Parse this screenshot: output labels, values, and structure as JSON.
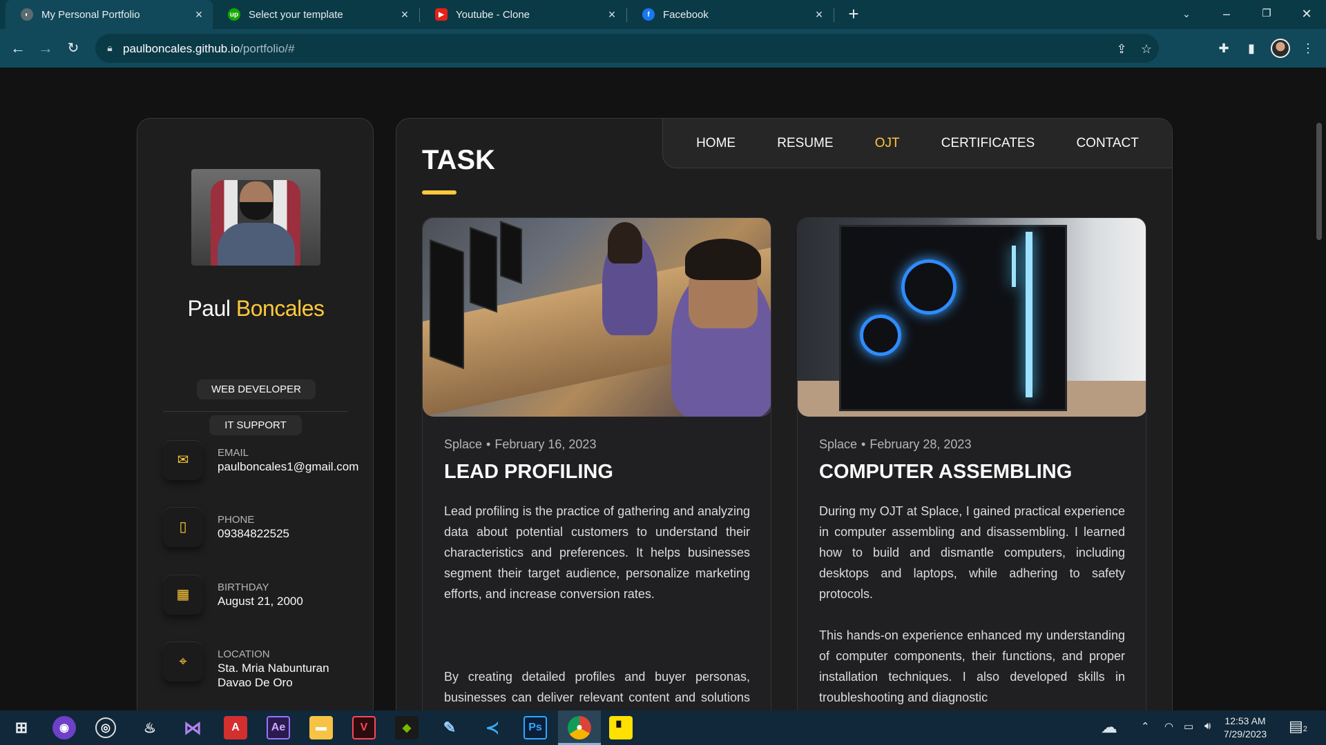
{
  "browser": {
    "tabs": [
      {
        "title": "My Personal Portfolio",
        "icon": "globe-icon",
        "active": true
      },
      {
        "title": "Select your template",
        "icon": "upwork-icon",
        "active": false
      },
      {
        "title": "Youtube - Clone",
        "icon": "youtube-icon",
        "active": false
      },
      {
        "title": "Facebook",
        "icon": "facebook-icon",
        "active": false
      }
    ],
    "url_host": "paulboncales.github.io",
    "url_path": "/portfolio/#"
  },
  "sidebar": {
    "first_name": "Paul",
    "last_name": "Boncales",
    "badges": [
      "WEB DEVELOPER",
      "IT SUPPORT"
    ],
    "contacts": [
      {
        "label": "EMAIL",
        "value": "paulboncales1@gmail.com",
        "icon": "mail-icon"
      },
      {
        "label": "PHONE",
        "value": "09384822525",
        "icon": "phone-icon"
      },
      {
        "label": "BIRTHDAY",
        "value": "August 21, 2000",
        "icon": "calendar-icon"
      },
      {
        "label": "LOCATION",
        "value": "Sta. Mria Nabunturan Davao De Oro",
        "icon": "location-icon"
      }
    ]
  },
  "nav": {
    "links": [
      "HOME",
      "RESUME",
      "OJT",
      "CERTIFICATES",
      "CONTACT"
    ],
    "active": "OJT"
  },
  "main": {
    "title": "TASK",
    "cards": [
      {
        "company": "Splace",
        "date": "February 16, 2023",
        "title": "LEAD PROFILING",
        "paragraphs": [
          "Lead profiling is the practice of gathering and analyzing data about potential customers to understand their characteristics and preferences. It helps businesses segment their target audience, personalize marketing efforts, and increase conversion rates.",
          "By creating detailed profiles and buyer personas, businesses can deliver relevant content and solutions to potential customers, enhancing"
        ]
      },
      {
        "company": "Splace",
        "date": "February 28, 2023",
        "title": "COMPUTER ASSEMBLING",
        "paragraphs": [
          "During my OJT at Splace, I gained practical experience in computer assembling and disassembling. I learned how to build and dismantle computers, including desktops and laptops, while adhering to safety protocols.",
          "This hands-on experience enhanced my understanding of computer components, their functions, and proper installation techniques. I also developed skills in troubleshooting and diagnostic"
        ]
      }
    ]
  },
  "taskbar": {
    "time": "12:53 AM",
    "date": "7/29/2023",
    "notification_count": "2"
  },
  "colors": {
    "accent": "#ffc93b",
    "background": "#121212",
    "panel": "#1e1e1f",
    "browser_chrome": "#11495a"
  }
}
